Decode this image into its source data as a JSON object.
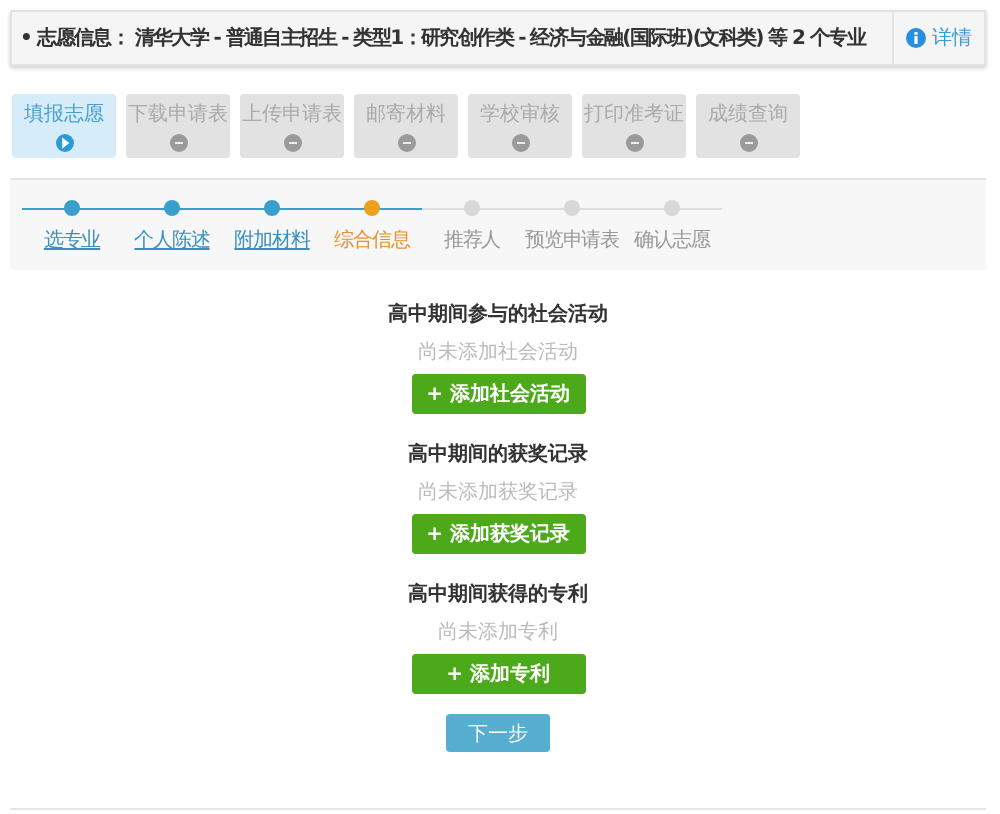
{
  "info_bar": {
    "bullet": "•",
    "text": "志愿信息： 清华大学 - 普通自主招生 - 类型1：研究创作类 - 经济与金融(国际班)(文科类) 等 2 个专业",
    "details_link": "详情"
  },
  "tabs": [
    {
      "label": "填报志愿",
      "selected": true
    },
    {
      "label": "下载申请表",
      "selected": false
    },
    {
      "label": "上传申请表",
      "selected": false
    },
    {
      "label": "邮寄材料",
      "selected": false
    },
    {
      "label": "学校审核",
      "selected": false
    },
    {
      "label": "打印准考证",
      "selected": false
    },
    {
      "label": "成绩查询",
      "selected": false
    }
  ],
  "steps": [
    {
      "label": "选专业",
      "kind": "done"
    },
    {
      "label": "个人陈述",
      "kind": "done"
    },
    {
      "label": "附加材料",
      "kind": "done"
    },
    {
      "label": "综合信息",
      "kind": "current"
    },
    {
      "label": "推荐人",
      "kind": "todo"
    },
    {
      "label": "预览申请表",
      "kind": "todo"
    },
    {
      "label": "确认志愿",
      "kind": "todo"
    }
  ],
  "sections": [
    {
      "title": "高中期间参与的社会活动",
      "empty_text": "尚未添加社会活动",
      "button": "+ 添加社会活动"
    },
    {
      "title": "高中期间的获奖记录",
      "empty_text": "尚未添加获奖记录",
      "button": "+ 添加获奖记录"
    },
    {
      "title": "高中期间获得的专利",
      "empty_text": "尚未添加专利",
      "button": "+ 添加专利"
    }
  ],
  "next_button": "下一步"
}
